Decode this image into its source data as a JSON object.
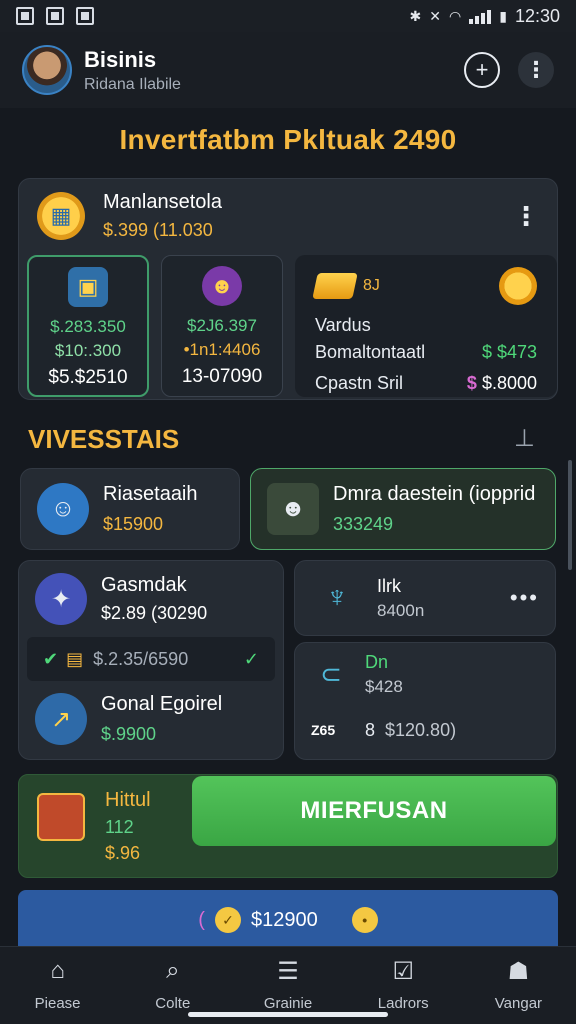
{
  "status": {
    "time": "12:30"
  },
  "header": {
    "title": "Bisinis",
    "subtitle": "Ridana Ilabile"
  },
  "page_title": "Invertfatbm Pkltuak 2490",
  "main_card": {
    "name": "Manlansetola",
    "value": "$.399 (11.030",
    "tile_a": {
      "line1": "$.283.350",
      "line2": "$10:.300",
      "line3": "$5.$2510"
    },
    "tile_b": {
      "line1": "$2J6.397",
      "line2": "•1n1:4406",
      "line3": "13-07090"
    },
    "tile_c": {
      "badge": "8J",
      "label1": "Vardus",
      "label2": "Bomaltontaatl",
      "label3": "Cpastn Sril",
      "trend_value": "$ $473",
      "amount": "$.8000"
    }
  },
  "section": {
    "title": "VIVESSTAIS"
  },
  "investments": {
    "left_top": {
      "name": "Riasetaaih",
      "value": "$15900"
    },
    "right_top": {
      "name": "Dmra daestein (iopprid",
      "value": "333249"
    },
    "left_mid": {
      "name": "Gasmdak",
      "value": "$2.89 (30290"
    },
    "left_row": {
      "value": "$.2.35/6590"
    },
    "left_bot": {
      "name": "Gonal Egoirel",
      "value": "$.9900"
    },
    "right_mid": {
      "name": "Ilrk",
      "value": "8400n"
    },
    "right_bot": {
      "name": "Dn",
      "value": "$428",
      "tag": "Z65",
      "tag2": "8",
      "amount": "$120.80)"
    }
  },
  "cta": {
    "label": "Hittul",
    "num": "112",
    "price": "$.96",
    "button": "MIERFUSAN"
  },
  "promo": {
    "amount": "$12900"
  },
  "nav": [
    {
      "label": "Piease",
      "icon": "home-icon"
    },
    {
      "label": "Colte",
      "icon": "search-icon"
    },
    {
      "label": "Grainie",
      "icon": "list-icon"
    },
    {
      "label": "Ladrors",
      "icon": "checkbox-icon"
    },
    {
      "label": "Vangar",
      "icon": "profile-icon"
    }
  ]
}
